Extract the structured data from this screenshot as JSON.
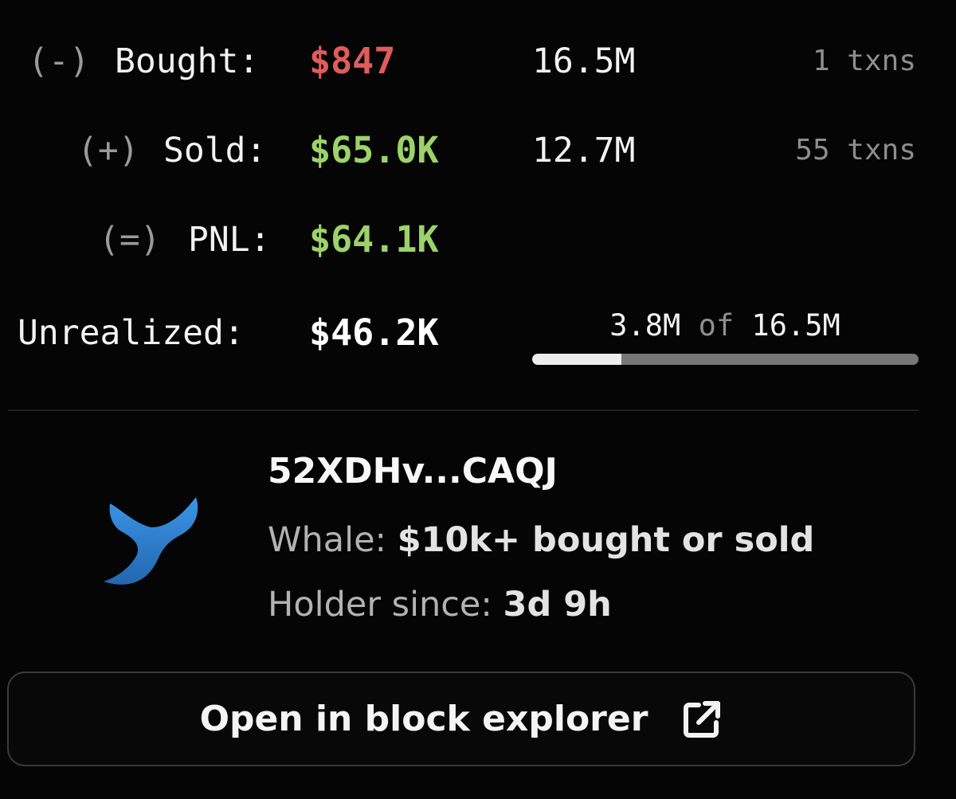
{
  "stats": {
    "bought": {
      "sign": "(-)",
      "label": "Bought:",
      "amount": "$847",
      "quantity": "16.5M",
      "txns": "1 txns",
      "color": "#e05c5c"
    },
    "sold": {
      "sign": "(+)",
      "label": "Sold:",
      "amount": "$65.0K",
      "quantity": "12.7M",
      "txns": "55 txns",
      "color": "#9bd36a"
    },
    "pnl": {
      "sign": "(=)",
      "label": "PNL:",
      "amount": "$64.1K",
      "color": "#9bd36a"
    },
    "unrealized": {
      "label": "Unrealized:",
      "amount": "$46.2K",
      "color": "#ffffff"
    }
  },
  "holdings": {
    "held": "3.8M",
    "of_label": "of",
    "total": "16.5M",
    "fraction": 0.23
  },
  "wallet": {
    "address": "52XDHv...CAQJ",
    "icon": "whale-tail-icon",
    "icon_color": "#2f7fd1",
    "whale_label": "Whale:",
    "whale_value": "$10k+ bought or sold",
    "holder_label": "Holder since:",
    "holder_value": "3d 9h"
  },
  "actions": {
    "explorer_label": "Open in block explorer",
    "explorer_icon": "external-link-icon"
  }
}
